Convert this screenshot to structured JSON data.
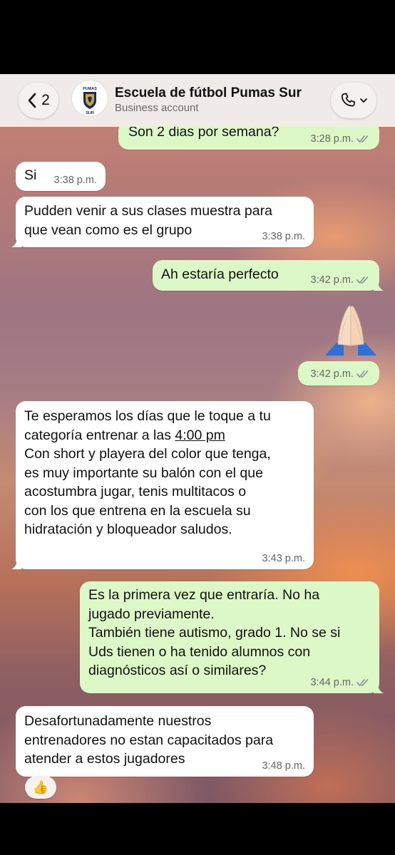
{
  "header": {
    "back_count": "2",
    "contact_name": "Escuela de fútbol Pumas Sur",
    "contact_subtitle": "Business account",
    "avatar_text_top": "PUMAS",
    "avatar_text_bottom": "SUR"
  },
  "messages": [
    {
      "direction": "out",
      "text": "Son 2 dias por semana?",
      "time": "3:28 p.m.",
      "status": "read"
    },
    {
      "direction": "in",
      "text": "Si",
      "time": "3:38 p.m."
    },
    {
      "direction": "in",
      "text": "Pudden venir a sus clases muestra para\nque vean como es el grupo",
      "time": "3:38 p.m."
    },
    {
      "direction": "out",
      "text": "Ah estaría perfecto",
      "time": "3:42 p.m.",
      "status": "read"
    },
    {
      "direction": "out",
      "emoji": "praying-hands",
      "time": "3:42 p.m.",
      "status": "read"
    },
    {
      "direction": "in",
      "text_before_link": "Te esperamos los días que le toque a tu\ncategoría entrenar a las ",
      "link": "4:00 pm",
      "text_after_link": "\nCon short y playera del color que tenga,\nes muy importante su balón con el que\nacostumbra jugar, tenis multitacos o\ncon los que entrena en la escuela su\nhidratación y bloqueador saludos.",
      "time": "3:43 p.m."
    },
    {
      "direction": "out",
      "text": "Es la primera vez que entraría. No ha\njugado previamente.\nTambién tiene autismo, grado 1. No se si\nUds tienen o ha tenido alumnos con\ndiagnósticos así o similares?",
      "time": "3:44 p.m.",
      "status": "read"
    },
    {
      "direction": "in",
      "text": "Desafortunadamente nuestros\nentrenadores no estan capacitados para\natender a estos jugadores",
      "time": "3:48 p.m.",
      "reaction": "👍"
    }
  ],
  "colors": {
    "incoming_bubble": "#ffffff",
    "outgoing_bubble": "#dcf8c6",
    "read_ticks": "#8a8f93",
    "header_bg": "#f0ece8"
  }
}
